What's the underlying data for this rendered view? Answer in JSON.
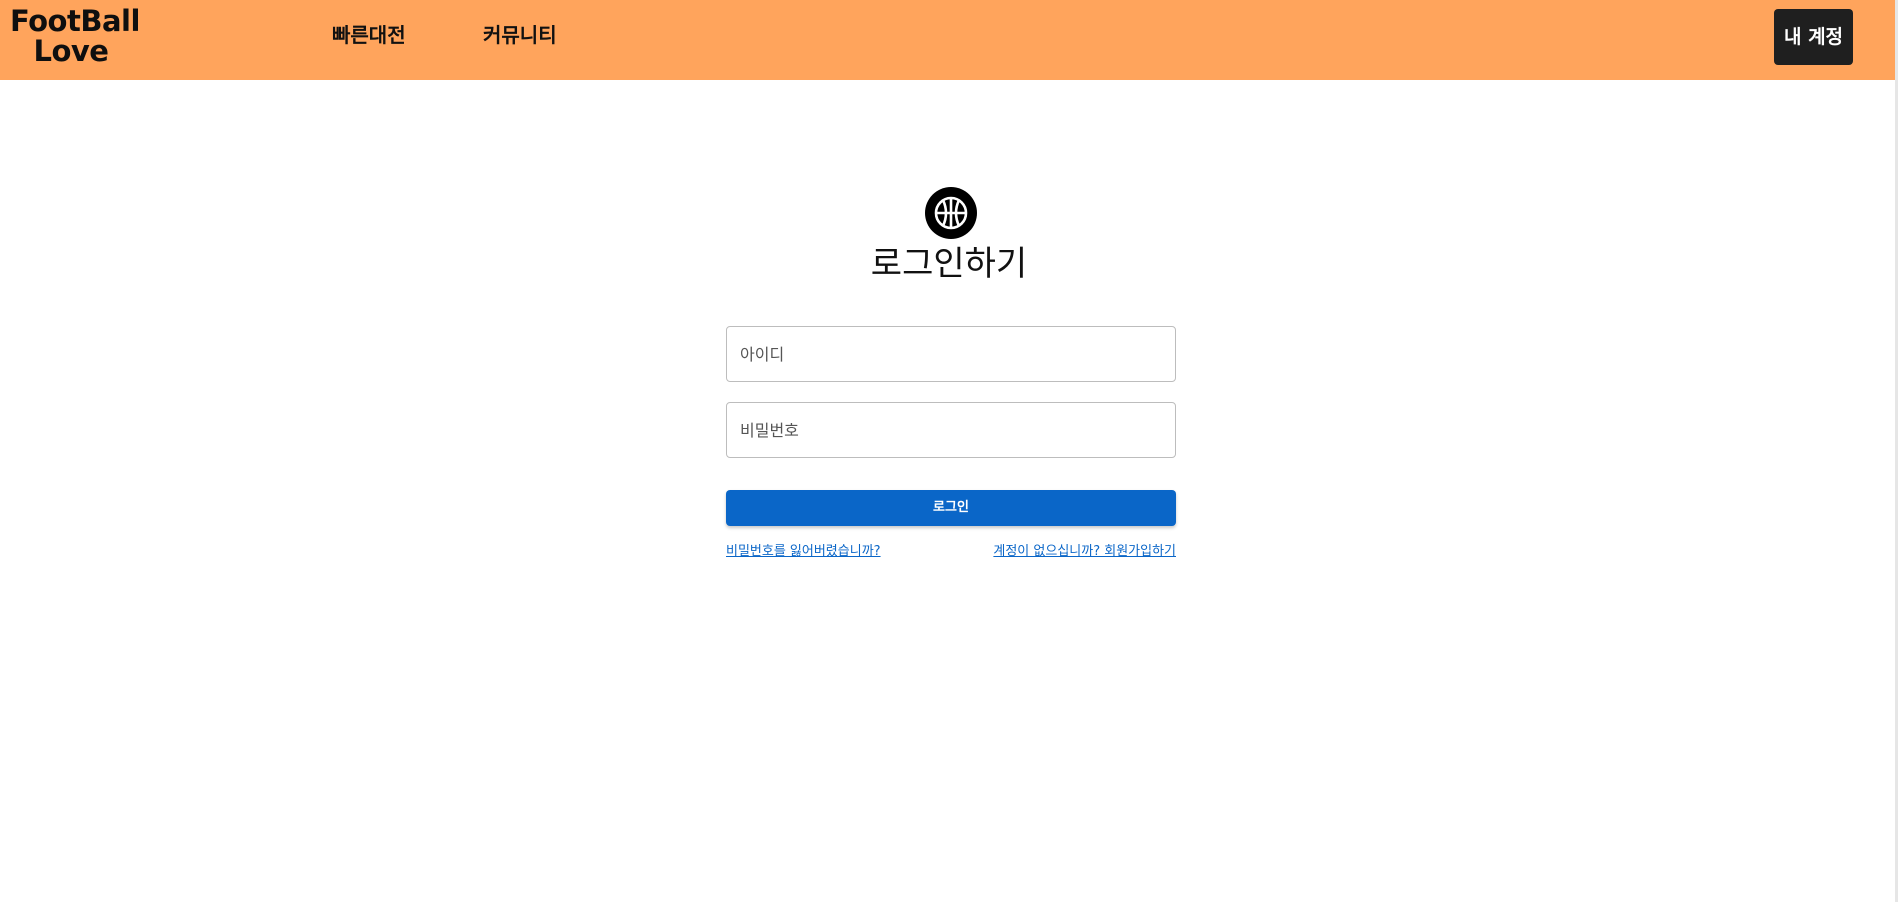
{
  "header": {
    "logo_line1": "FootBall",
    "logo_line2": "Love",
    "nav": [
      {
        "label": "빠른대전"
      },
      {
        "label": "커뮤니티"
      }
    ],
    "account_label": "내 계정"
  },
  "login": {
    "icon": "basketball-icon",
    "title": "로그인하기",
    "id_placeholder": "아이디",
    "password_placeholder": "비밀번호",
    "submit_label": "로그인",
    "forgot_link": "비밀번호를 잃어버렸습니까?",
    "signup_link": "계정이 없으십니까? 회원가입하기"
  },
  "colors": {
    "header_bg": "#ffa45c",
    "account_button_bg": "#1f1f1f",
    "primary": "#0a66c8",
    "link": "#0a66c8"
  }
}
